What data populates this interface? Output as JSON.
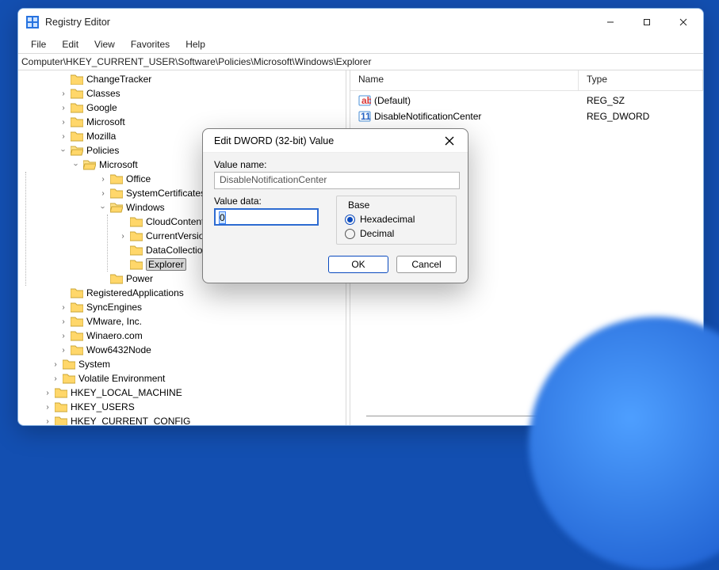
{
  "titlebar": {
    "title": "Registry Editor"
  },
  "menubar": {
    "file": "File",
    "edit": "Edit",
    "view": "View",
    "favorites": "Favorites",
    "help": "Help"
  },
  "addressbar": {
    "path": "Computer\\HKEY_CURRENT_USER\\Software\\Policies\\Microsoft\\Windows\\Explorer"
  },
  "tree": {
    "labels": {
      "ChangeTracker": "ChangeTracker",
      "Classes": "Classes",
      "Google": "Google",
      "Microsoft1": "Microsoft",
      "Mozilla": "Mozilla",
      "Policies": "Policies",
      "MicrosoftP": "Microsoft",
      "Office": "Office",
      "SystemCertificates": "SystemCertificates",
      "Windows": "Windows",
      "CloudContent": "CloudContent",
      "CurrentVersion": "CurrentVersion",
      "DataCollection": "DataCollection",
      "Explorer": "Explorer",
      "Power": "Power",
      "RegisteredApplications": "RegisteredApplications",
      "SyncEngines": "SyncEngines",
      "VMware": "VMware, Inc.",
      "Winaero": "Winaero.com",
      "Wow6432Node": "Wow6432Node",
      "System": "System",
      "Volatile": "Volatile Environment",
      "HKLM": "HKEY_LOCAL_MACHINE",
      "HKU": "HKEY_USERS",
      "HKCC": "HKEY_CURRENT_CONFIG"
    }
  },
  "list": {
    "cols": {
      "name": "Name",
      "type": "Type"
    },
    "rows": [
      {
        "icon": "string-icon",
        "name": "(Default)",
        "type": "REG_SZ"
      },
      {
        "icon": "dword-icon",
        "name": "DisableNotificationCenter",
        "type": "REG_DWORD"
      }
    ]
  },
  "dialog": {
    "title": "Edit DWORD (32-bit) Value",
    "value_name_label": "Value name:",
    "value_name": "DisableNotificationCenter",
    "value_data_label": "Value data:",
    "value_data": "0",
    "base_label": "Base",
    "hex_label": "Hexadecimal",
    "dec_label": "Decimal",
    "ok": "OK",
    "cancel": "Cancel"
  }
}
